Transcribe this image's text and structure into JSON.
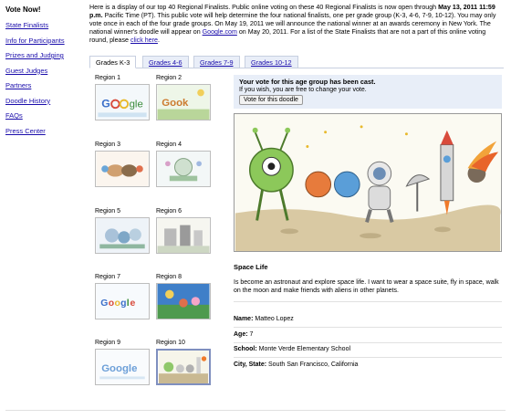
{
  "sidebar": {
    "title": "Vote Now!",
    "links": [
      "State Finalists",
      "Info for Participants",
      "Prizes and Judging",
      "Guest Judges",
      "Partners",
      "Doodle History",
      "FAQs",
      "Press Center"
    ]
  },
  "intro": {
    "p1": "Here is a display of our top 40 Regional Finalists. Public online voting on these 40 Regional Finalists is now open through ",
    "deadline": "May 13, 2011 11:59 p.m.",
    "p2": " Pacific Time (PT). This public vote will help determine the four national finalists, one per grade group (K-3, 4-6, 7-9, 10-12). You may only vote once in each of the four grade groups. On May 19, 2011 we will announce the national winner at an awards ceremony in New York. The national winner's doodle will appear on ",
    "google_link": "Google.com",
    "p3": " on May 20, 2011. For a list of the State Finalists that are not a part of this online voting round, please ",
    "click_link": "click here",
    "p4": "."
  },
  "tabs": [
    {
      "label": "Grades K-3",
      "active": true
    },
    {
      "label": "Grades 4-6",
      "active": false
    },
    {
      "label": "Grades 7-9",
      "active": false
    },
    {
      "label": "Grades 10-12",
      "active": false
    }
  ],
  "regions": [
    "Region 1",
    "Region 2",
    "Region 3",
    "Region 4",
    "Region 5",
    "Region 6",
    "Region 7",
    "Region 8",
    "Region 9",
    "Region 10"
  ],
  "selected_region": "Region 10",
  "vote": {
    "title": "Your vote for this age group has been cast.",
    "subtitle": "If you wish, you are free to change your vote.",
    "button": "Vote for this doodle"
  },
  "doodle": {
    "title": "Space Life",
    "description": "Is become an astronaut and explore space life. I want to wear a space suite, fly in space, walk on the moon and make friends with aliens in other planets."
  },
  "details": {
    "name_label": "Name:",
    "name": "Matteo Lopez",
    "age_label": "Age:",
    "age": "7",
    "school_label": "School:",
    "school": "Monte Verde Elementary School",
    "city_label": "City, State:",
    "city": "South San Francisco, California"
  },
  "colors": {
    "link": "#1a0dab",
    "tab_bg": "#e9eef8",
    "vote_bg": "#e8eef8"
  }
}
